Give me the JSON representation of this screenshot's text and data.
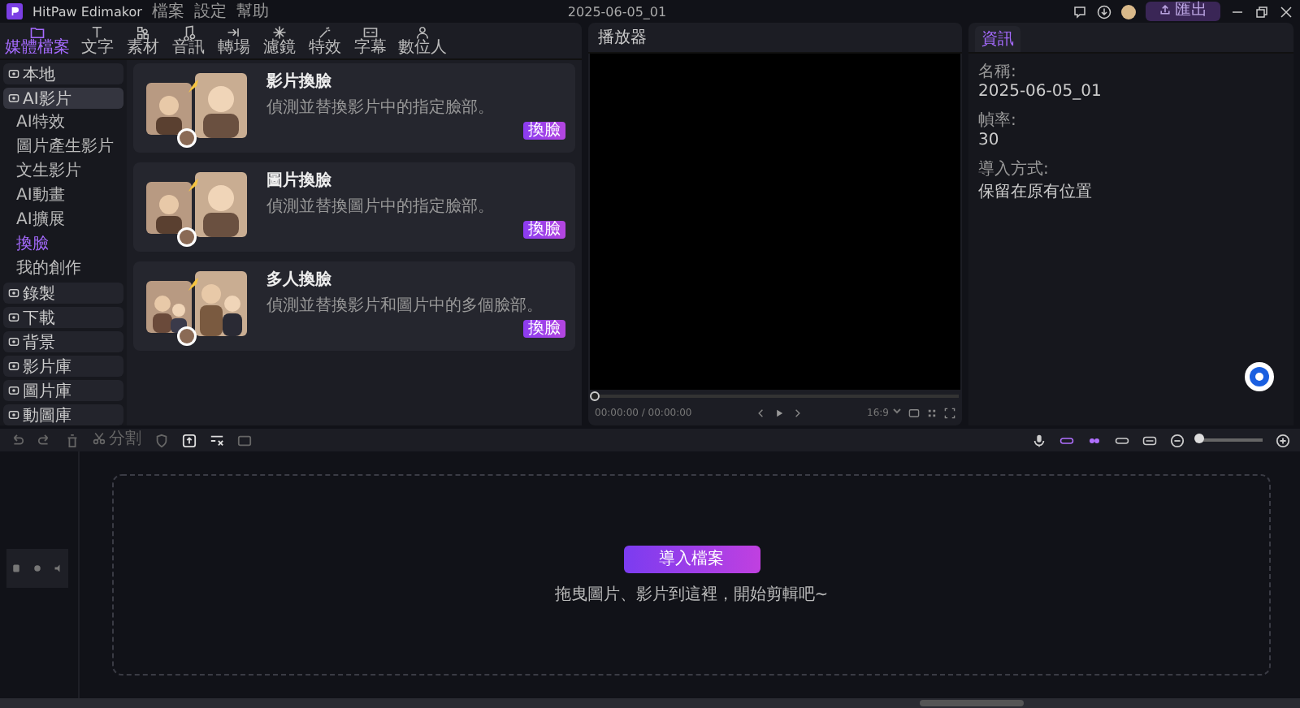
{
  "app": {
    "name": "HitPaw Edimakor",
    "menu": [
      "檔案",
      "設定",
      "幫助"
    ],
    "project_title": "2025-06-05_01",
    "export_label": "匯出"
  },
  "toolbar": [
    {
      "label": "媒體檔案",
      "selected": true
    },
    {
      "label": "文字",
      "selected": false
    },
    {
      "label": "素材",
      "selected": false
    },
    {
      "label": "音訊",
      "selected": false
    },
    {
      "label": "轉場",
      "selected": false
    },
    {
      "label": "濾鏡",
      "selected": false
    },
    {
      "label": "特效",
      "selected": false
    },
    {
      "label": "字幕",
      "selected": false
    },
    {
      "label": "數位人",
      "selected": false
    }
  ],
  "sidebar": [
    {
      "label": "本地",
      "selected": false
    },
    {
      "label": "AI影片",
      "selected": true,
      "children": [
        {
          "label": "AI特效",
          "selected": false
        },
        {
          "label": "圖片產生影片",
          "selected": false
        },
        {
          "label": "文生影片",
          "selected": false
        },
        {
          "label": "AI動畫",
          "selected": false
        },
        {
          "label": "AI擴展",
          "selected": false
        },
        {
          "label": "換臉",
          "selected": true
        },
        {
          "label": "我的創作",
          "selected": false
        }
      ]
    },
    {
      "label": "錄製",
      "selected": false
    },
    {
      "label": "下載",
      "selected": false
    },
    {
      "label": "背景",
      "selected": false
    },
    {
      "label": "影片庫",
      "selected": false
    },
    {
      "label": "圖片庫",
      "selected": false
    },
    {
      "label": "動圖庫",
      "selected": false
    }
  ],
  "cards": [
    {
      "title": "影片換臉",
      "description": "偵測並替換影片中的指定臉部。",
      "button": "換臉",
      "kind": "single"
    },
    {
      "title": "圖片換臉",
      "description": "偵測並替換圖片中的指定臉部。",
      "button": "換臉",
      "kind": "single"
    },
    {
      "title": "多人換臉",
      "description": "偵測並替換影片和圖片中的多個臉部。",
      "button": "換臉",
      "kind": "group"
    }
  ],
  "player": {
    "title": "播放器",
    "time": "00:00:00 / 00:00:00",
    "ratio": "16:9",
    "level": 0
  },
  "info": {
    "tab": "資訊",
    "fields": [
      {
        "label": "名稱:",
        "value": "2025-06-05_01"
      },
      {
        "label": "幀率:",
        "value": "30"
      },
      {
        "label": "導入方式:",
        "value": "保留在原有位置"
      }
    ]
  },
  "timeline_toolbar": {
    "split_label": "分割",
    "zoom": {
      "level": 0.03
    }
  },
  "timeline": {
    "import_button": "導入檔案",
    "hint": "拖曳圖片、影片到這裡，開始剪輯吧~"
  }
}
